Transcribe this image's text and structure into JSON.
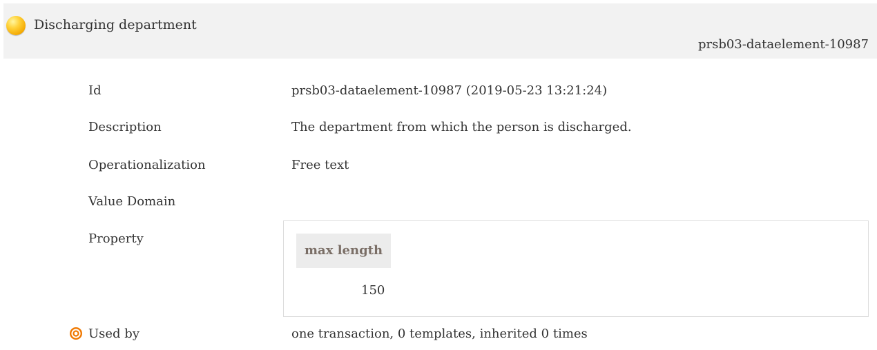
{
  "header": {
    "title": "Discharging department",
    "ref_id": "prsb03-dataelement-10987"
  },
  "rows": {
    "id": {
      "label": "Id",
      "value": "prsb03-dataelement-10987 (2019-05-23 13:21:24)"
    },
    "description": {
      "label": "Description",
      "value": "The department from which the person is discharged."
    },
    "operationalization": {
      "label": "Operationalization",
      "value": "Free text"
    },
    "value_domain": {
      "label": "Value Domain"
    },
    "property": {
      "label": "Property",
      "column_header": "max length",
      "value": "150"
    },
    "used_by": {
      "label": "Used by",
      "value": "one transaction, 0 templates, inherited 0 times",
      "icon": "target-icon"
    }
  },
  "colors": {
    "header_bg": "#f2f2f2",
    "status_dot": "#f4a800",
    "target_icon": "#f07800",
    "property_header_text": "#7a6e66"
  }
}
